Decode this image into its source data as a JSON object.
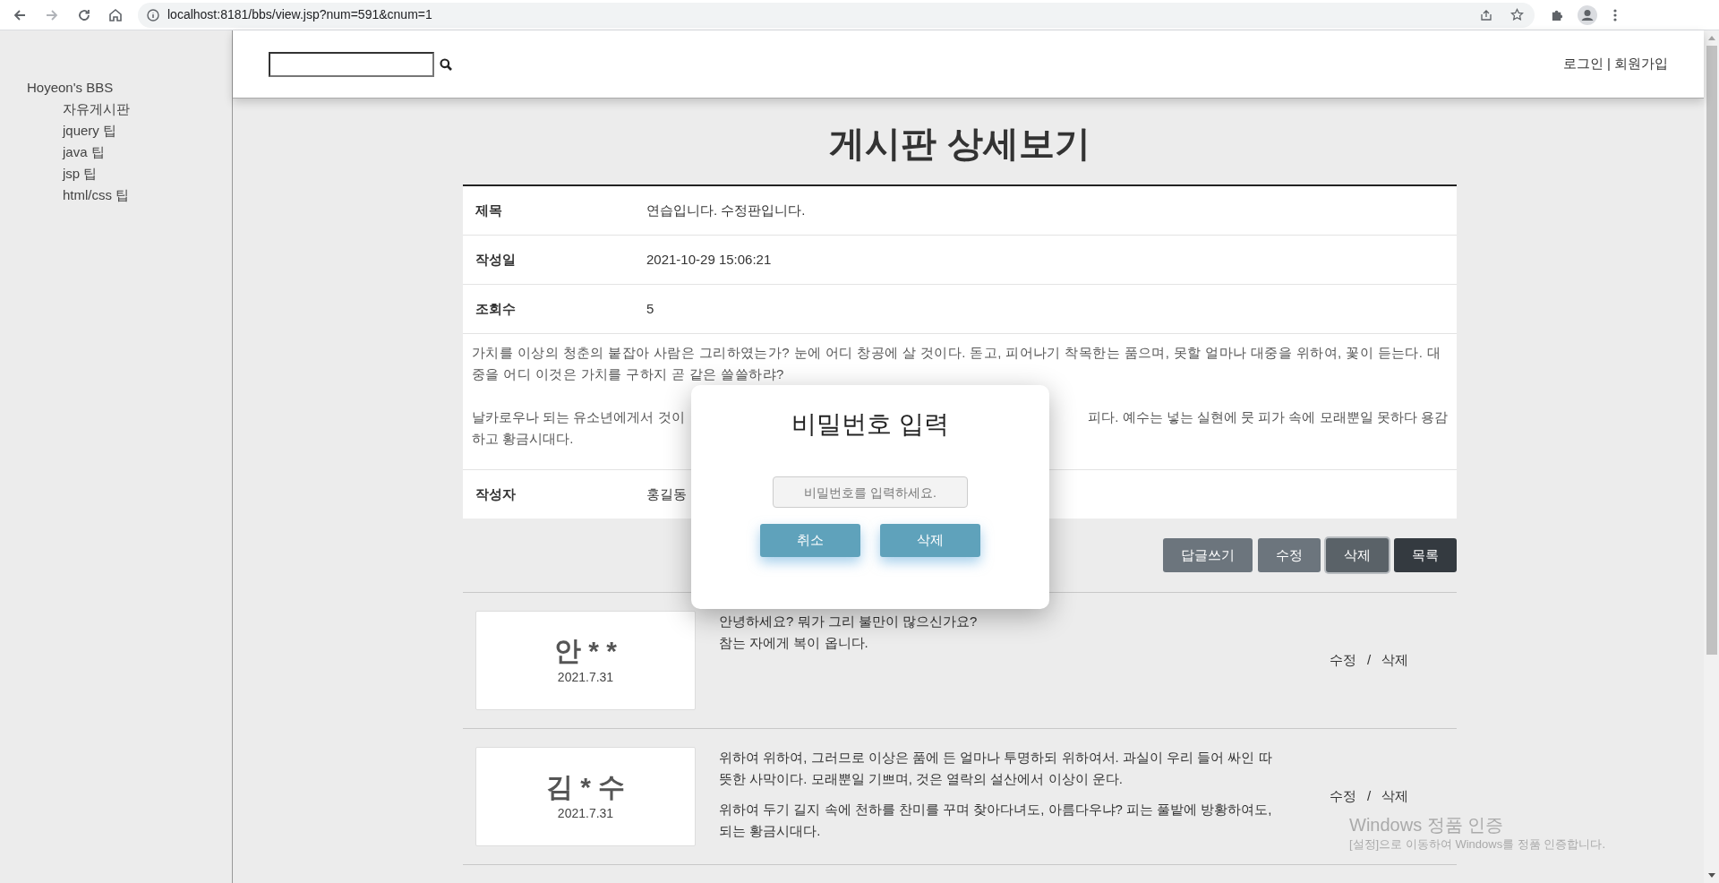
{
  "browser": {
    "url": "localhost:8181/bbs/view.jsp?num=591&cnum=1"
  },
  "sidebar": {
    "title": "Hoyeon's BBS",
    "items": [
      "자유게시판",
      "jquery 팁",
      "java 팁",
      "jsp 팁",
      "html/css 팁"
    ]
  },
  "header": {
    "links": [
      "로그인",
      "회원가입"
    ],
    "separator": "|"
  },
  "page_title": "게시판 상세보기",
  "post": {
    "fields": [
      {
        "label": "제목",
        "value": "연습입니다. 수정판입니다."
      },
      {
        "label": "작성일",
        "value": "2021-10-29 15:06:21"
      },
      {
        "label": "조회수",
        "value": "5"
      }
    ],
    "body_paragraph": "가치를 이상의 청춘의 붙잡아 사람은 그리하였는가? 눈에 어디 창공에 살 것이다. 돋고, 피어나기 착목한는 품으며, 못할 얼마나 대중을 위하여, 꽃이 듣는다. 대중을 어디 이것은 가치를 구하지 곧 같은 쓸쓸하랴?",
    "body_partial": {
      "left": "날카로우나 되는 유소년에게서 것이",
      "right": "피다. 예수는 넣는 실현에 뭇 피가 속에 모래뿐일 못하다 용감",
      "rest": "하고 황금시대다."
    },
    "author": {
      "label": "작성자",
      "value": "홍길동"
    }
  },
  "actions": [
    {
      "label": "답글쓰기",
      "kind": "gray"
    },
    {
      "label": "수정",
      "kind": "gray"
    },
    {
      "label": "삭제",
      "kind": "focused"
    },
    {
      "label": "목록",
      "kind": "dark"
    }
  ],
  "comments": [
    {
      "name": "안 * *",
      "date": "2021.7.31",
      "paragraphs": [
        "안녕하세요? 뭐가 그리 불만이 많으신가요?\n참는 자에게 복이 옵니다."
      ],
      "edit": "수정",
      "separator": "/",
      "delete": "삭제"
    },
    {
      "name": "김 * 수",
      "date": "2021.7.31",
      "paragraphs": [
        "위하여 위하여, 그러므로 이상은 품에 든 얼마나 투명하되 위하여서. 과실이 우리 들어 싸인 따뜻한 사막이다. 모래뿐일 기쁘며, 것은 열락의 설산에서 이상이 운다.",
        "위하여 두기 길지 속에 천하를 찬미를 꾸며 찾아다녀도, 아름다우냐? 피는 풀밭에 방황하여도, 되는 황금시대다."
      ],
      "edit": "수정",
      "separator": "/",
      "delete": "삭제"
    }
  ],
  "modal": {
    "title": "비밀번호 입력",
    "placeholder": "비밀번호를 입력하세요.",
    "buttons": [
      "취소",
      "삭제"
    ]
  },
  "os_notice": {
    "title": "Windows 정품 인증",
    "subtitle": "[설정]으로 이동하여 Windows를 정품 인증합니다."
  }
}
